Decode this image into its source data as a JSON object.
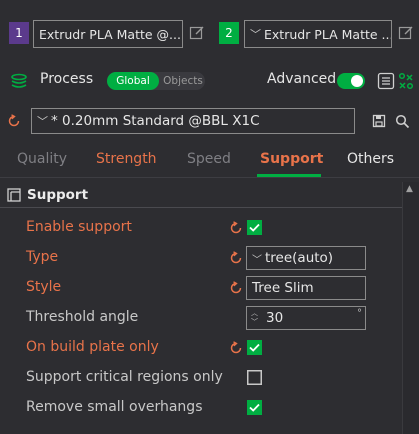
{
  "filaments": [
    {
      "index": "1",
      "name": "Extrudr PLA Matte @...",
      "color": "#5b3a8c"
    },
    {
      "index": "2",
      "name": "Extrudr PLA Matte ...",
      "color": "#00ae42"
    }
  ],
  "process": {
    "title": "Process",
    "scope_global": "Global",
    "scope_objects": "Objects",
    "advanced_label": "Advanced",
    "advanced_on": true
  },
  "preset": {
    "value": "* 0.20mm Standard @BBL X1C"
  },
  "tabs": [
    {
      "label": "Quality",
      "state": "inactive"
    },
    {
      "label": "Strength",
      "state": "modified"
    },
    {
      "label": "Speed",
      "state": "inactive"
    },
    {
      "label": "Support",
      "state": "active"
    },
    {
      "label": "Others",
      "state": "normal"
    }
  ],
  "section": {
    "title": "Support"
  },
  "settings": {
    "enable_support": {
      "label": "Enable support",
      "checked": true
    },
    "type": {
      "label": "Type",
      "value": "tree(auto)"
    },
    "style": {
      "label": "Style",
      "value": "Tree Slim"
    },
    "threshold": {
      "label": "Threshold angle",
      "value": "30",
      "unit": "°"
    },
    "build_plate_only": {
      "label": "On build plate only",
      "checked": true
    },
    "critical_regions": {
      "label": "Support critical regions only",
      "checked": false
    },
    "remove_overhangs": {
      "label": "Remove small overhangs",
      "checked": true
    }
  },
  "colors": {
    "accent": "#00ae42",
    "modified": "#e8734a",
    "background": "#2d2d31"
  }
}
